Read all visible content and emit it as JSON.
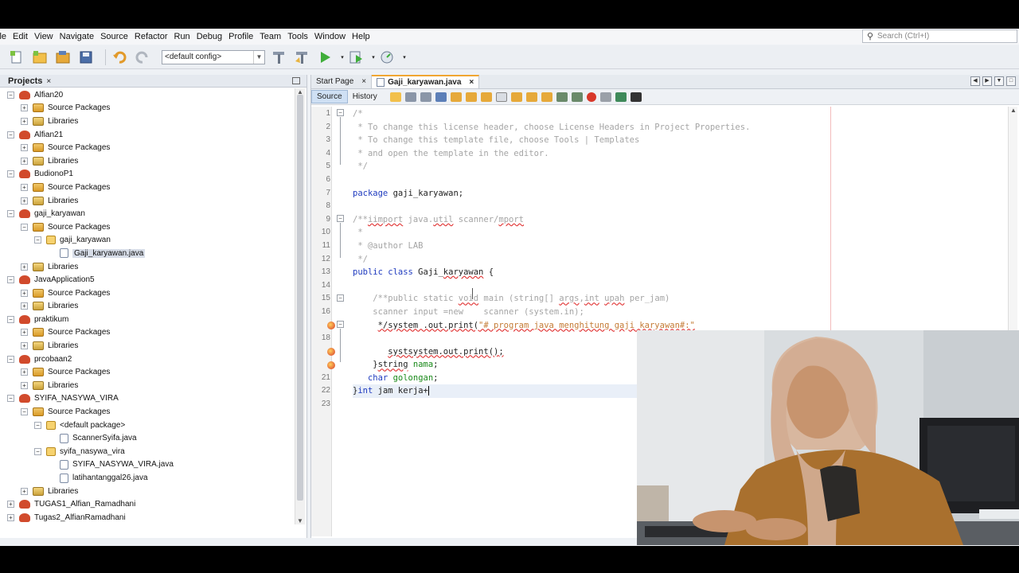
{
  "menu": [
    "ile",
    "Edit",
    "View",
    "Navigate",
    "Source",
    "Refactor",
    "Run",
    "Debug",
    "Profile",
    "Team",
    "Tools",
    "Window",
    "Help"
  ],
  "search": {
    "placeholder": "Search (Ctrl+I)"
  },
  "toolbar": {
    "config": "<default config>"
  },
  "projects": {
    "title": "Projects",
    "close": "×",
    "rows": [
      {
        "indent": 0,
        "tog": "−",
        "icon": "proj",
        "label": "Alfian20"
      },
      {
        "indent": 1,
        "tog": "+",
        "icon": "pkg",
        "label": "Source Packages"
      },
      {
        "indent": 1,
        "tog": "+",
        "icon": "lib",
        "label": "Libraries"
      },
      {
        "indent": 0,
        "tog": "−",
        "icon": "proj",
        "label": "Alfian21"
      },
      {
        "indent": 1,
        "tog": "+",
        "icon": "pkg",
        "label": "Source Packages"
      },
      {
        "indent": 1,
        "tog": "+",
        "icon": "lib",
        "label": "Libraries"
      },
      {
        "indent": 0,
        "tog": "−",
        "icon": "proj",
        "label": "BudionoP1"
      },
      {
        "indent": 1,
        "tog": "+",
        "icon": "pkg",
        "label": "Source Packages"
      },
      {
        "indent": 1,
        "tog": "+",
        "icon": "lib",
        "label": "Libraries"
      },
      {
        "indent": 0,
        "tog": "−",
        "icon": "proj",
        "label": "gaji_karyawan"
      },
      {
        "indent": 1,
        "tog": "−",
        "icon": "pkg",
        "label": "Source Packages"
      },
      {
        "indent": 2,
        "tog": "−",
        "icon": "jpkg",
        "label": "gaji_karyawan"
      },
      {
        "indent": 3,
        "tog": "",
        "icon": "java",
        "label": "Gaji_karyawan.java",
        "selected": true
      },
      {
        "indent": 1,
        "tog": "+",
        "icon": "lib",
        "label": "Libraries"
      },
      {
        "indent": 0,
        "tog": "−",
        "icon": "proj",
        "label": "JavaApplication5"
      },
      {
        "indent": 1,
        "tog": "+",
        "icon": "pkg",
        "label": "Source Packages"
      },
      {
        "indent": 1,
        "tog": "+",
        "icon": "lib",
        "label": "Libraries"
      },
      {
        "indent": 0,
        "tog": "−",
        "icon": "proj",
        "label": "praktikum"
      },
      {
        "indent": 1,
        "tog": "+",
        "icon": "pkg",
        "label": "Source Packages"
      },
      {
        "indent": 1,
        "tog": "+",
        "icon": "lib",
        "label": "Libraries"
      },
      {
        "indent": 0,
        "tog": "−",
        "icon": "proj",
        "label": "prcobaan2"
      },
      {
        "indent": 1,
        "tog": "+",
        "icon": "pkg",
        "label": "Source Packages"
      },
      {
        "indent": 1,
        "tog": "+",
        "icon": "lib",
        "label": "Libraries"
      },
      {
        "indent": 0,
        "tog": "−",
        "icon": "proj",
        "label": "SYIFA_NASYWA_VIRA"
      },
      {
        "indent": 1,
        "tog": "−",
        "icon": "pkg",
        "label": "Source Packages"
      },
      {
        "indent": 2,
        "tog": "−",
        "icon": "jpkg",
        "label": "<default package>"
      },
      {
        "indent": 3,
        "tog": "",
        "icon": "java",
        "label": "ScannerSyifa.java"
      },
      {
        "indent": 2,
        "tog": "−",
        "icon": "jpkg",
        "label": "syifa_nasywa_vira"
      },
      {
        "indent": 3,
        "tog": "",
        "icon": "java",
        "label": "SYIFA_NASYWA_VIRA.java"
      },
      {
        "indent": 3,
        "tog": "",
        "icon": "java",
        "label": "latihantanggal26.java"
      },
      {
        "indent": 1,
        "tog": "+",
        "icon": "lib",
        "label": "Libraries"
      },
      {
        "indent": 0,
        "tog": "+",
        "icon": "proj",
        "label": "TUGAS1_Alfian_Ramadhani"
      },
      {
        "indent": 0,
        "tog": "+",
        "icon": "proj",
        "label": "Tugas2_AlfianRamadhani"
      }
    ]
  },
  "tabs": [
    {
      "label": "Start Page",
      "close": "×",
      "active": false
    },
    {
      "label": "Gaji_karyawan.java",
      "close": "×",
      "active": true
    }
  ],
  "editor": {
    "source_label": "Source",
    "history_label": "History",
    "lines": [
      {
        "n": "1",
        "html": "<span class='cm'>/*</span>"
      },
      {
        "n": "2",
        "html": "<span class='cm'> * To change this license header, choose License Headers in Project Properties.</span>"
      },
      {
        "n": "3",
        "html": "<span class='cm'> * To change this template file, choose Tools | Templates</span>"
      },
      {
        "n": "4",
        "html": "<span class='cm'> * and open the template in the editor.</span>"
      },
      {
        "n": "5",
        "html": "<span class='cm'> */</span>"
      },
      {
        "n": "6",
        "html": ""
      },
      {
        "n": "7",
        "html": "<span class='kw'>package</span> gaji_karyawan;"
      },
      {
        "n": "8",
        "html": ""
      },
      {
        "n": "9",
        "html": "<span class='cm'>/**<span class='err'>iimport</span> java.<span class='err'>util</span> scanner/<span class='err'>mport</span></span>"
      },
      {
        "n": "10",
        "html": "<span class='cm'> *</span>"
      },
      {
        "n": "11",
        "html": "<span class='cm'> * @author LAB</span>"
      },
      {
        "n": "12",
        "html": "<span class='cm'> */</span>"
      },
      {
        "n": "13",
        "html": "<span class='kw'>public class</span> Gaji_<span class='err'>karyawan</span> {"
      },
      {
        "n": "14",
        "html": ""
      },
      {
        "n": "15",
        "html": "    <span class='cm'>/**public static <span class='err'>void</span> main (string[] <span class='err'>args</span>,<span class='err'>int</span> <span class='err'>upah</span> per_jam)</span>"
      },
      {
        "n": "16",
        "html": "    <span class='cm'>scanner input =new    scanner (system.in);</span>"
      },
      {
        "n": "",
        "html": "     <span class='err'>*/system .out.print(<span class='str'>\"# program java menghitung gaji karyawan#:\"</span></span>"
      },
      {
        "n": "18",
        "html": ""
      },
      {
        "n": "",
        "html": "       <span class='err'>systsystem.out.print();</span>"
      },
      {
        "n": "",
        "html": "    }<span class='err'>string</span> <span class='field'>nama</span>;"
      },
      {
        "n": "21",
        "html": "   <span class='kw'>char</span> <span class='field'>golongan</span>;"
      },
      {
        "n": "22",
        "html": "}<span class='kw'>int</span> jam kerja+<span class='caret'></span>",
        "current": true
      },
      {
        "n": "23",
        "html": ""
      }
    ]
  }
}
